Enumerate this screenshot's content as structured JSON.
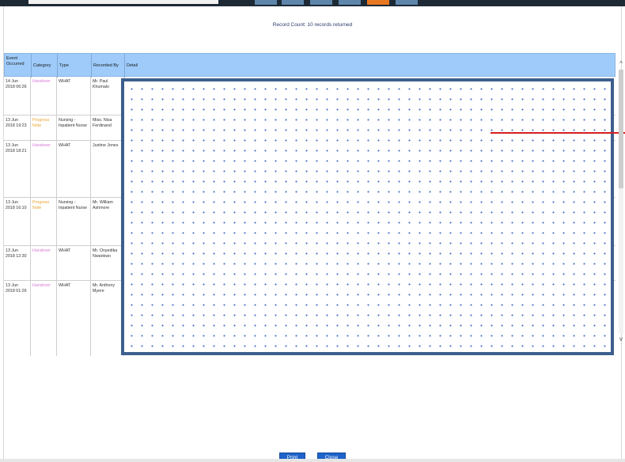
{
  "header": {
    "record_count": "Record Count: 10 records returned"
  },
  "table": {
    "columns": [
      "Event Occurred",
      "Category",
      "Type",
      "Recorded By",
      "Detail"
    ],
    "rows": [
      {
        "event": "14 Jun 2018 06:26",
        "category": "Handover",
        "type": "WHAT",
        "recorded_by": "Mr. Paul Khumalo"
      },
      {
        "event": "13 Jun 2018 19:23",
        "category": "Progress Note",
        "type": "Nursing - Inpatient Nurse",
        "recorded_by": "Miss. Nisa Ferdinand"
      },
      {
        "event": "13 Jun 2018 18:21",
        "category": "Handover",
        "type": "WHAT",
        "recorded_by": "Justine Jones"
      },
      {
        "event": "13 Jun 2018 16:10",
        "category": "Progress Note",
        "type": "Nursing - Inpatient Nurse",
        "recorded_by": "Mr. William Ashmore"
      },
      {
        "event": "13 Jun 2018 12:30",
        "category": "Handover",
        "type": "WHAT",
        "recorded_by": "Mr. Onyedika Nwankwo"
      },
      {
        "event": "13 Jun 2018 01:26",
        "category": "Handover",
        "type": "WHAT",
        "recorded_by": "Mr. Anthony Myere"
      }
    ]
  },
  "scrollbar": {
    "up_icon": "chevron-up-icon",
    "down_icon": "chevron-down-icon",
    "up_glyph": "^",
    "down_glyph": "v"
  },
  "footer": {
    "print_label": "Print",
    "close_label": "Close"
  },
  "colors": {
    "header_bg": "#9ecbf9",
    "handover": "#d77ad6",
    "progress_note": "#e8a431",
    "button": "#1e63c9",
    "detail_border": "#3d5f8e"
  }
}
